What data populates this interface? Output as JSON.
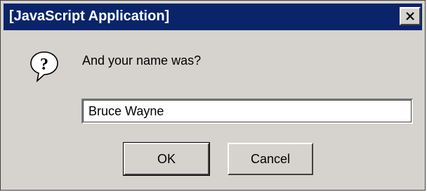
{
  "window": {
    "title": "[JavaScript Application]",
    "close_label": "X",
    "titlebar_color": "#0a246a",
    "face_color": "#d6d3ce"
  },
  "dialog": {
    "icon": "question-icon",
    "prompt": "And your name was?",
    "input_value": "Bruce Wayne",
    "ok_label": "OK",
    "cancel_label": "Cancel"
  }
}
